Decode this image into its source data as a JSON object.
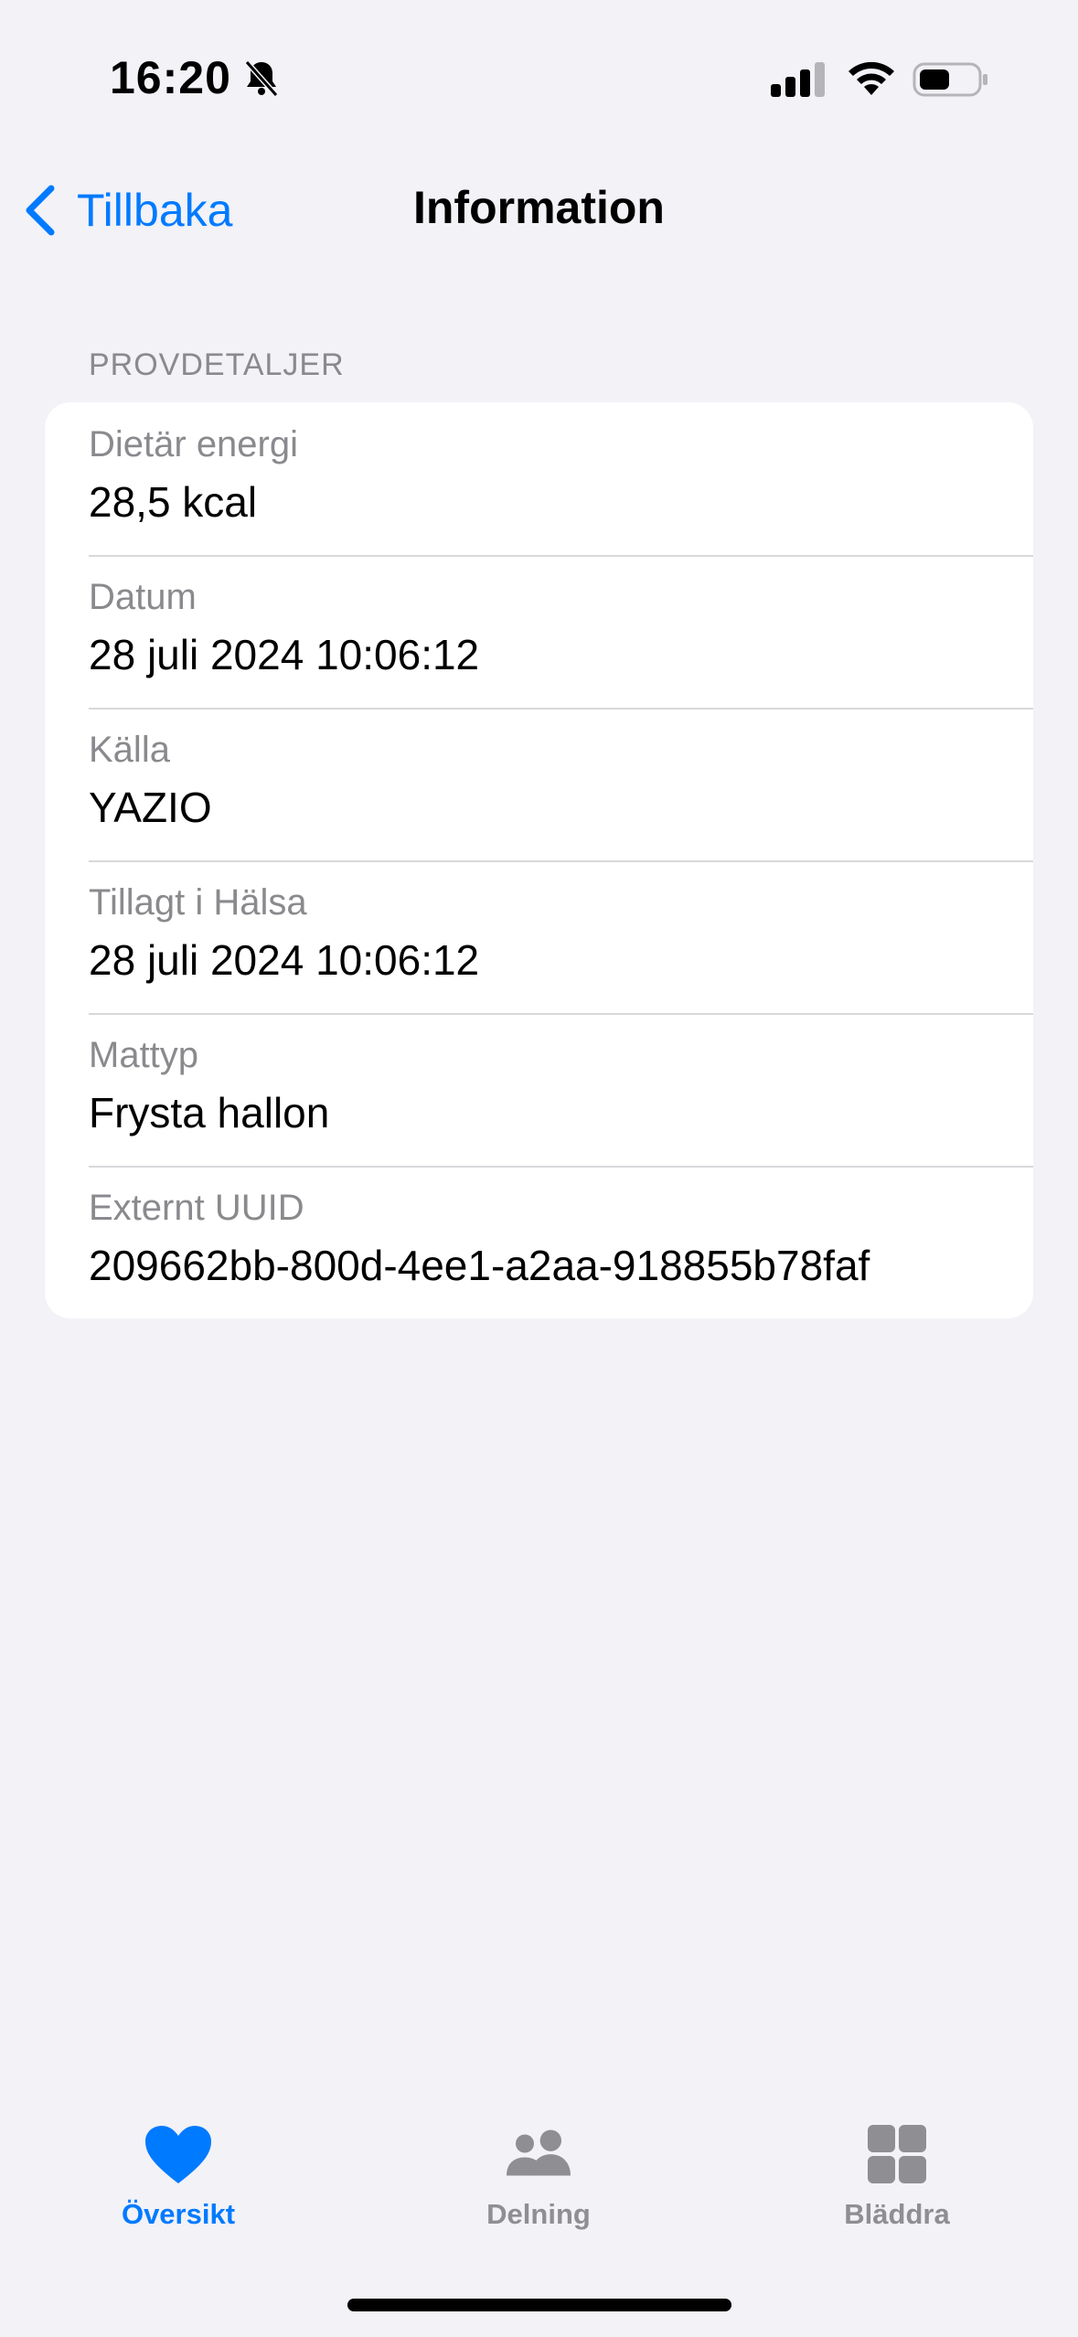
{
  "status_bar": {
    "time": "16:20"
  },
  "nav": {
    "back_label": "Tillbaka",
    "title": "Information"
  },
  "section": {
    "header": "PROVDETALJER",
    "rows": [
      {
        "label": "Dietär energi",
        "value": "28,5 kcal"
      },
      {
        "label": "Datum",
        "value": "28 juli 2024 10:06:12"
      },
      {
        "label": "Källa",
        "value": "YAZIO"
      },
      {
        "label": "Tillagt i Hälsa",
        "value": "28 juli 2024 10:06:12"
      },
      {
        "label": "Mattyp",
        "value": "Frysta hallon"
      },
      {
        "label": "Externt UUID",
        "value": "209662bb-800d-4ee1-a2aa-918855b78faf"
      }
    ]
  },
  "tabs": [
    {
      "label": "Översikt",
      "icon": "heart-icon",
      "active": true
    },
    {
      "label": "Delning",
      "icon": "people-icon",
      "active": false
    },
    {
      "label": "Bläddra",
      "icon": "grid-icon",
      "active": false
    }
  ],
  "colors": {
    "accent": "#007aff",
    "background": "#f2f2f7",
    "secondary_text": "#8a8a8e",
    "inactive_tab": "#8e8e93"
  }
}
